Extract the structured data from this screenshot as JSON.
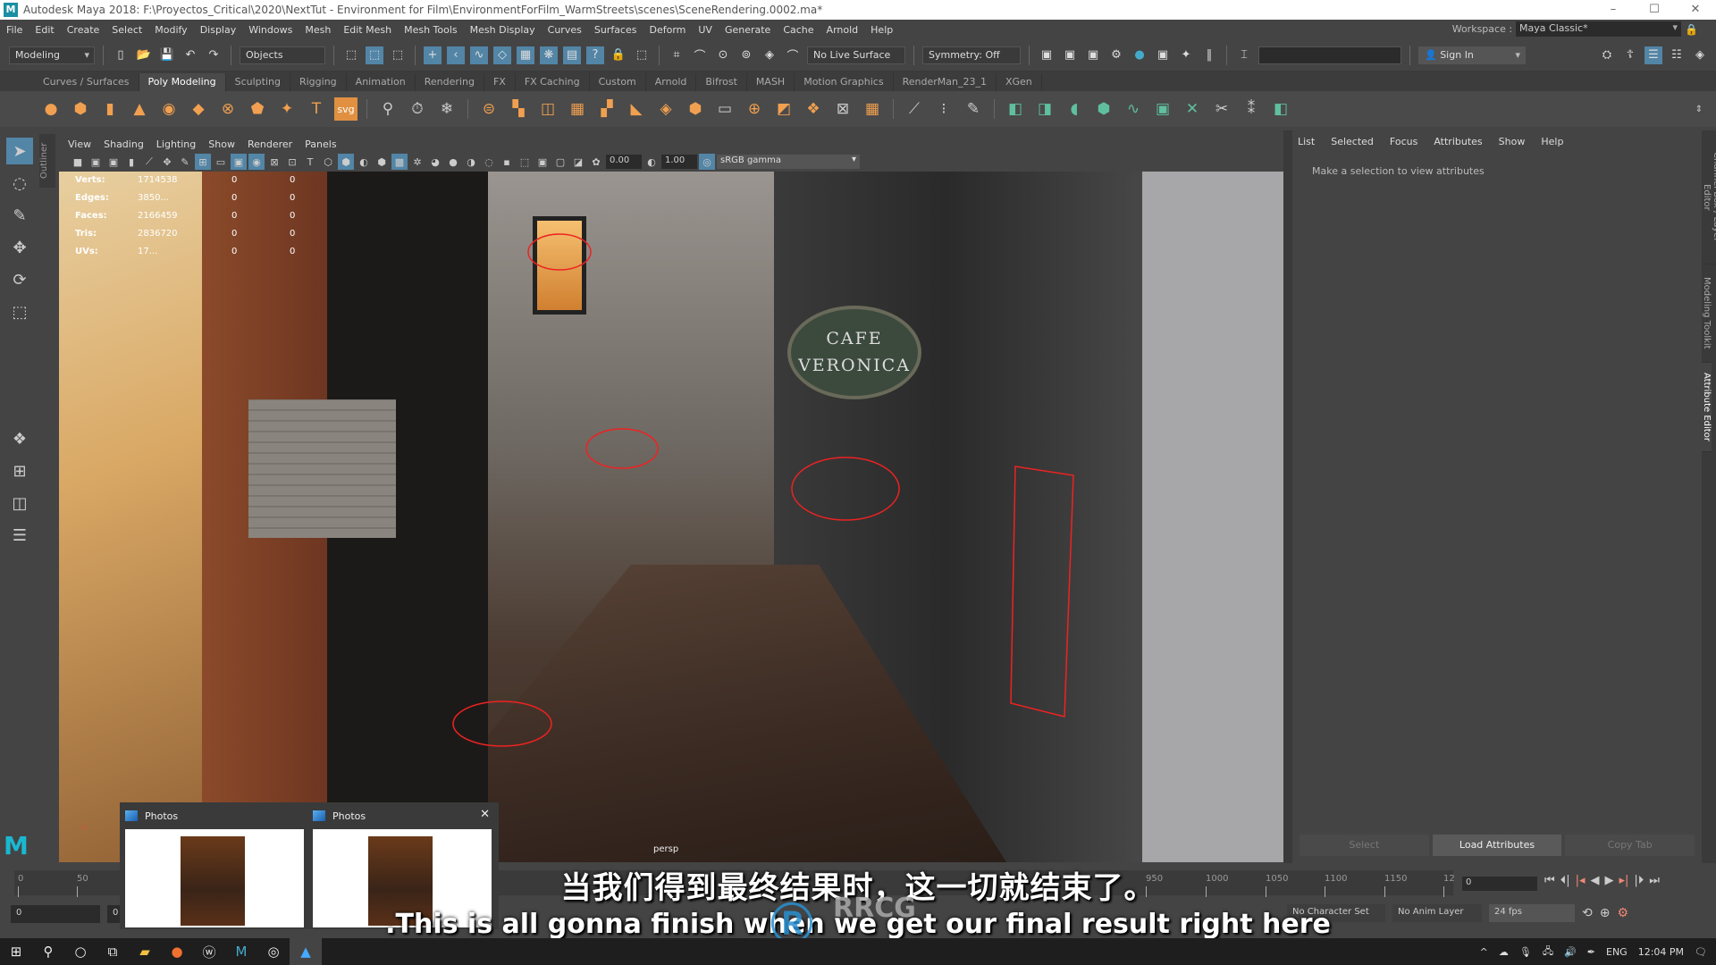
{
  "window": {
    "title": "Autodesk Maya 2018: F:\\Proyectos_Critical\\2020\\NextTut - Environment for Film\\EnvironmentForFilm_WarmStreets\\scenes\\SceneRendering.0002.ma*",
    "controls": {
      "minimize": "–",
      "maximize": "☐",
      "close": "✕"
    }
  },
  "menubar": {
    "items": [
      "File",
      "Edit",
      "Create",
      "Select",
      "Modify",
      "Display",
      "Windows",
      "Mesh",
      "Edit Mesh",
      "Mesh Tools",
      "Mesh Display",
      "Curves",
      "Surfaces",
      "Deform",
      "UV",
      "Generate",
      "Cache",
      "Arnold",
      "Help"
    ],
    "workspace_label": "Workspace :",
    "workspace_value": "Maya Classic*"
  },
  "statusline": {
    "mode": "Modeling",
    "selection_mask": "Objects",
    "live_surface": "No Live Surface",
    "symmetry": "Symmetry: Off",
    "sign_in": "Sign In"
  },
  "shelf": {
    "tabs": [
      "Curves / Surfaces",
      "Poly Modeling",
      "Sculpting",
      "Rigging",
      "Animation",
      "Rendering",
      "FX",
      "FX Caching",
      "Custom",
      "Arnold",
      "Bifrost",
      "MASH",
      "Motion Graphics",
      "RenderMan_23_1",
      "XGen"
    ],
    "active_tab": "Poly Modeling",
    "text_tool": "T",
    "svg_tool": "svg"
  },
  "outliner_tab": "Outliner",
  "viewport": {
    "menu": [
      "View",
      "Shading",
      "Lighting",
      "Show",
      "Renderer",
      "Panels"
    ],
    "exposure": "0.00",
    "gamma": "1.00",
    "color_space": "sRGB gamma",
    "camera_label": "persp",
    "hud": [
      {
        "label": "Verts:",
        "value": "1714538",
        "sel": "0",
        "comp": "0"
      },
      {
        "label": "Edges:",
        "value": "3850...",
        "sel": "0",
        "comp": "0"
      },
      {
        "label": "Faces:",
        "value": "2166459",
        "sel": "0",
        "comp": "0"
      },
      {
        "label": "Tris:",
        "value": "2836720",
        "sel": "0",
        "comp": "0"
      },
      {
        "label": "UVs:",
        "value": "17...",
        "sel": "0",
        "comp": "0"
      }
    ],
    "sign_text": "CAFE\nVERONICA"
  },
  "attribute_editor": {
    "menu": [
      "List",
      "Selected",
      "Focus",
      "Attributes",
      "Show",
      "Help"
    ],
    "message": "Make a selection to view attributes",
    "buttons": {
      "select": "Select",
      "load": "Load Attributes",
      "copy": "Copy Tab"
    }
  },
  "side_tabs": [
    "Channel Box / Layer Editor",
    "Modeling Toolkit",
    "Attribute Editor"
  ],
  "timeline": {
    "ticks": [
      "0",
      "50",
      "950",
      "1000",
      "1050",
      "1100",
      "1150",
      "12"
    ],
    "current_frame": "0",
    "range_start": "0",
    "range_start2": "0",
    "character_set": "No Character Set",
    "anim_layer": "No Anim Layer",
    "fps": "24 fps"
  },
  "task_preview": {
    "windows": [
      {
        "title": "Photos"
      },
      {
        "title": "Photos"
      }
    ]
  },
  "subtitles": {
    "cn": "当我们得到最终结果时，这一切就结束了。",
    "en": ".This is all gonna finish when we get our final result right here"
  },
  "watermark": "RRCG",
  "taskbar": {
    "language": "ENG",
    "time": "12:04 PM"
  },
  "colors": {
    "accent": "#5285a6",
    "shelf_poly": "#f0a050",
    "shelf_uv": "#5fbf9f",
    "panel_bg": "#444444"
  }
}
